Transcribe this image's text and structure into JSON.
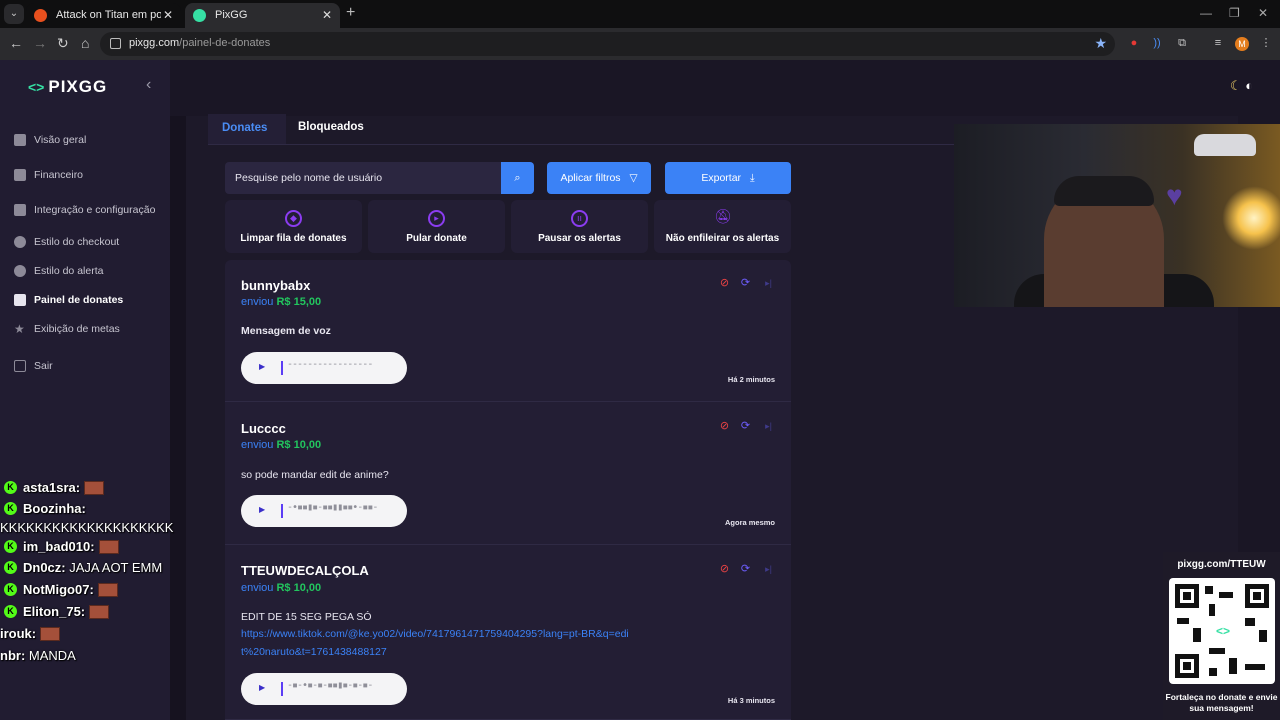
{
  "browser": {
    "tabs": [
      {
        "label": "Attack on Titan em português b",
        "favicon_color": "#e8501e"
      },
      {
        "label": "PixGG",
        "favicon_color": "#36e0a4"
      }
    ],
    "url_host": "pixgg.com",
    "url_path": "/painel-de-donates",
    "profile_initial": "M"
  },
  "sidebar": {
    "logo_text": "PIXGG",
    "items": [
      {
        "label": "Visão geral",
        "icon": "home-icon"
      },
      {
        "label": "Financeiro",
        "icon": "wallet-icon"
      },
      {
        "label": "Integração e configuração",
        "icon": "settings-icon"
      },
      {
        "label": "Estilo do checkout",
        "icon": "palette-icon"
      },
      {
        "label": "Estilo do alerta",
        "icon": "palette-icon"
      },
      {
        "label": "Painel de donates",
        "icon": "donate-icon",
        "active": true
      },
      {
        "label": "Exibição de metas",
        "icon": "star-icon"
      },
      {
        "label": "Sair",
        "icon": "logout-icon"
      }
    ]
  },
  "main": {
    "tabs": [
      {
        "label": "Donates",
        "active": true
      },
      {
        "label": "Bloqueados"
      }
    ],
    "search_placeholder": "Pesquise pelo nome de usuário",
    "filters_label": "Aplicar filtros",
    "export_label": "Exportar",
    "actions": [
      {
        "label": "Limpar fila de donates",
        "icon": "eraser-icon"
      },
      {
        "label": "Pular donate",
        "icon": "skip-icon"
      },
      {
        "label": "Pausar os alertas",
        "icon": "pause-icon"
      },
      {
        "label": "Não enfileirar os alertas",
        "icon": "bell-off-icon"
      }
    ],
    "sent_label": "enviou",
    "donations": [
      {
        "name": "bunnybabx",
        "amount": "R$ 15,00",
        "message": "Mensagem de voz",
        "link": "",
        "time": "Há 2 minutos",
        "wave": "-----------------"
      },
      {
        "name": "Lucccc",
        "amount": "R$ 10,00",
        "message": "so pode mandar edit de anime?",
        "link": "",
        "time": "Agora mesmo",
        "wave": "-•▪▪▮▪-▪▪▮▮▪▪•-▪▪-"
      },
      {
        "name": "TTEUWDECALÇOLA",
        "amount": "R$ 10,00",
        "message": "EDIT DE 15 SEG PEGA SÓ",
        "link": "https://www.tiktok.com/@ke.yo02/video/7417961471759404295?lang=pt-BR&q=edit%20naruto&t=1761438488127",
        "time": "Há 3 minutos",
        "wave": "-▪-•▪-▪-▪▪▮▪-▪-▪-"
      }
    ]
  },
  "chat": [
    {
      "user": "asta1sra:",
      "msg": "",
      "badge": true,
      "emote": true
    },
    {
      "user": "Boozinha:",
      "msg": "",
      "badge": true,
      "emote": false
    },
    {
      "user": "",
      "msg": "KKKKKKKKKKKKKKKKKKKK",
      "badge": false,
      "emote": false
    },
    {
      "user": "im_bad010:",
      "msg": "",
      "badge": true,
      "emote": true
    },
    {
      "user": "Dn0cz:",
      "msg": "JAJA AOT EMM",
      "badge": true,
      "emote": false
    },
    {
      "user": "NotMigo07:",
      "msg": "",
      "badge": true,
      "emote": true
    },
    {
      "user": "Eliton_75:",
      "msg": "",
      "badge": true,
      "emote": true
    },
    {
      "user": "irouk:",
      "msg": "",
      "badge": false,
      "emote": true
    },
    {
      "user": "nbr:",
      "msg": "MANDA",
      "badge": false,
      "emote": false
    }
  ],
  "qr": {
    "url": "pixgg.com/TTEUW",
    "caption": "Fortaleça no donate e envie sua mensagem!"
  },
  "colors": {
    "accent": "#3b82f6",
    "amount": "#22c55e",
    "brand": "#36e0a4",
    "sidebar_bg": "#211c31",
    "page_bg": "#1a1625"
  }
}
